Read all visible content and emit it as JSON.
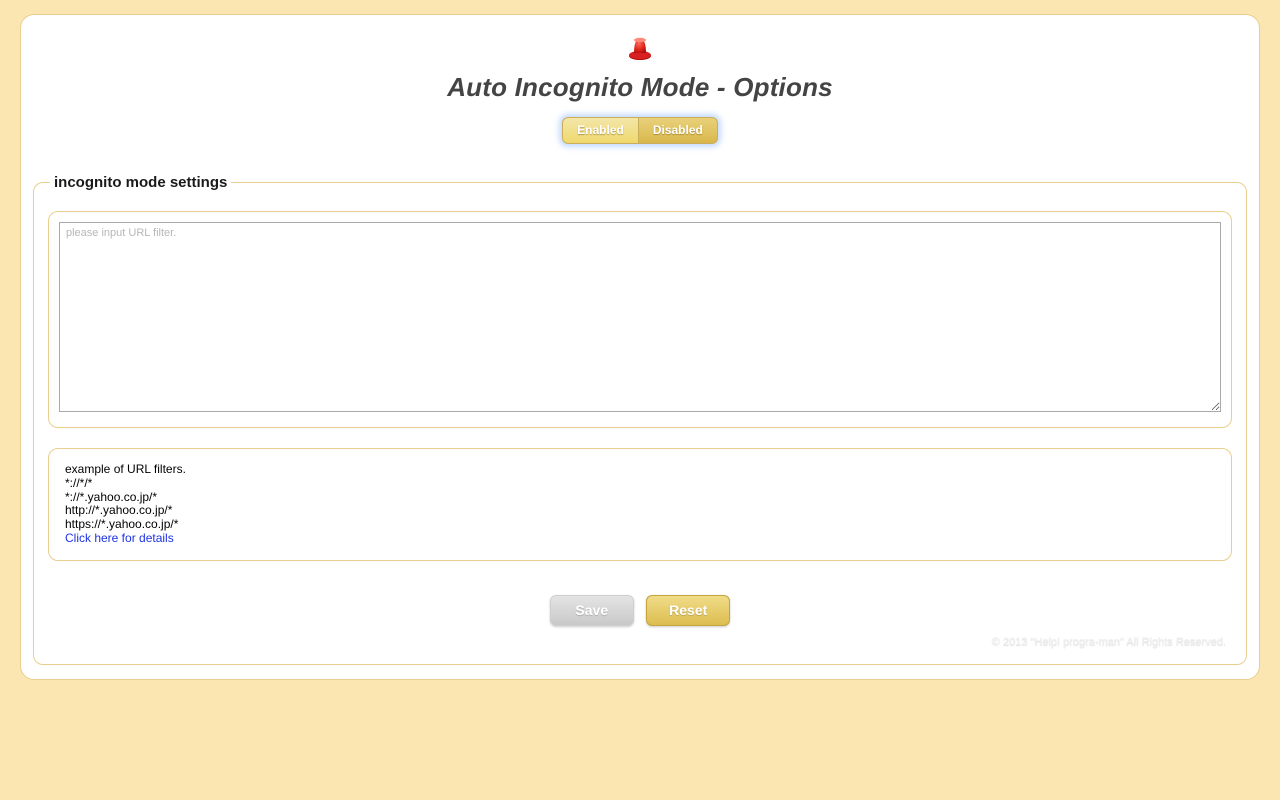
{
  "title": "Auto Incognito Mode - Options",
  "toggle": {
    "enabled_label": "Enabled",
    "disabled_label": "Disabled"
  },
  "settings": {
    "legend": "incognito mode settings",
    "url_filter_value": "",
    "url_filter_placeholder": "please input URL filter."
  },
  "examples": {
    "line1": "example of URL filters.",
    "line2": "*://*/*",
    "line3": "*://*.yahoo.co.jp/*",
    "line4": "http://*.yahoo.co.jp/*",
    "line5": "https://*.yahoo.co.jp/*",
    "link_text": "Click here for details"
  },
  "actions": {
    "save_label": "Save",
    "reset_label": "Reset"
  },
  "footer": "© 2013 \"Help! progra-man\" All Rights Reserved."
}
